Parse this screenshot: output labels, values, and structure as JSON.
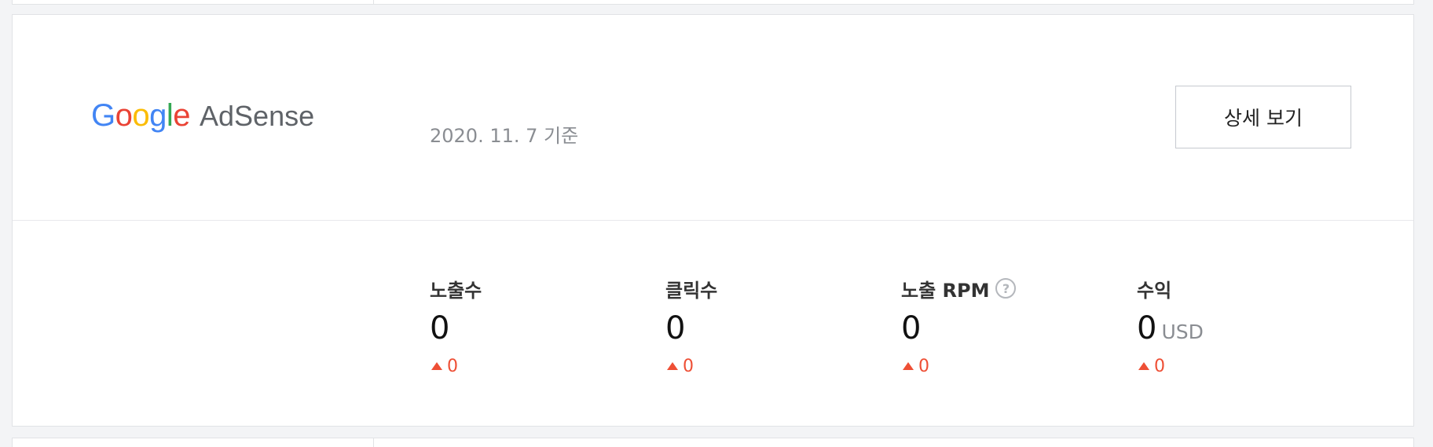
{
  "header": {
    "logo_google": "Google",
    "logo_product": "AdSense",
    "date_label": "2020. 11. 7 기준",
    "detail_button_label": "상세 보기"
  },
  "stats": [
    {
      "label": "노출수",
      "value": "0",
      "unit": "",
      "change": "0",
      "has_help": false
    },
    {
      "label": "클릭수",
      "value": "0",
      "unit": "",
      "change": "0",
      "has_help": false
    },
    {
      "label": "노출 RPM",
      "value": "0",
      "unit": "",
      "change": "0",
      "has_help": true
    },
    {
      "label": "수익",
      "value": "0",
      "unit": "USD",
      "change": "0",
      "has_help": false
    }
  ],
  "icons": {
    "help": "question-circle-icon",
    "change": "triangle-up-icon"
  },
  "colors": {
    "google_blue": "#4285F4",
    "google_red": "#EA4335",
    "google_yellow": "#FBBC05",
    "google_green": "#34A853",
    "adsense_gray": "#5f6368",
    "change_red": "#ee4f35",
    "background": "#f3f4f6"
  }
}
